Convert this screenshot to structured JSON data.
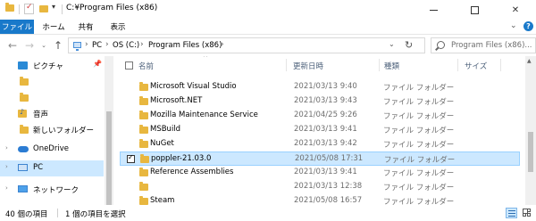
{
  "titlebar": {
    "path": "C:¥Program Files (x86)",
    "dropdown_glyph": "▾",
    "win_close_glyph": "✕"
  },
  "ribbon": {
    "tabs": [
      "ファイル",
      "ホーム",
      "共有",
      "表示"
    ],
    "expand_glyph": "⌄",
    "help_glyph": "?",
    "file_tab_color": "#1979ca"
  },
  "address": {
    "crumbs": [
      "PC",
      "OS (C:)",
      "Program Files (x86)"
    ],
    "sep_glyph": "›",
    "dropdown_glyph": "⌄",
    "refresh_glyph": "↻",
    "search_placeholder": "Program Files (x86)..."
  },
  "nav_buttons": {
    "back": "←",
    "forward": "→",
    "recent": "⌄",
    "up": "↑"
  },
  "navpane": {
    "items": [
      {
        "label": "ピクチャ",
        "icon": "pictures-icon",
        "pinned": true
      },
      {
        "label": "",
        "icon": "folder-icon"
      },
      {
        "label": "",
        "icon": "folder-icon"
      },
      {
        "label": "音声",
        "icon": "music-folder-icon"
      },
      {
        "label": "新しいフォルダー",
        "icon": "folder-icon"
      },
      {
        "label": "OneDrive",
        "icon": "onedrive-icon"
      },
      {
        "label": "PC",
        "icon": "pc-icon",
        "selected": true
      },
      {
        "label": "ネットワーク",
        "icon": "network-icon"
      }
    ],
    "pin_glyph": "📌",
    "expander_glyph": "›"
  },
  "columns": {
    "name": "名前",
    "date": "更新日時",
    "type": "種類",
    "size": "サイズ",
    "sort_glyph": "^"
  },
  "files": [
    {
      "name": "Microsoft Visual Studio",
      "date": "2021/03/13 9:40",
      "type": "ファイル フォルダー"
    },
    {
      "name": "Microsoft.NET",
      "date": "2021/03/13 9:43",
      "type": "ファイル フォルダー"
    },
    {
      "name": "Mozilla Maintenance Service",
      "date": "2021/04/25 9:26",
      "type": "ファイル フォルダー"
    },
    {
      "name": "MSBuild",
      "date": "2021/03/13 9:41",
      "type": "ファイル フォルダー"
    },
    {
      "name": "NuGet",
      "date": "2021/03/13 9:42",
      "type": "ファイル フォルダー"
    },
    {
      "name": "poppler-21.03.0",
      "date": "2021/05/08 17:31",
      "type": "ファイル フォルダー",
      "selected": true
    },
    {
      "name": "Reference Assemblies",
      "date": "2021/03/13 9:41",
      "type": "ファイル フォルダー"
    },
    {
      "name": "",
      "date": "2021/03/13 12:38",
      "type": "ファイル フォルダー"
    },
    {
      "name": "Steam",
      "date": "2021/05/08 16:57",
      "type": "ファイル フォルダー"
    }
  ],
  "status": {
    "count": "40 個の項目",
    "selection": "1 個の項目を選択"
  }
}
